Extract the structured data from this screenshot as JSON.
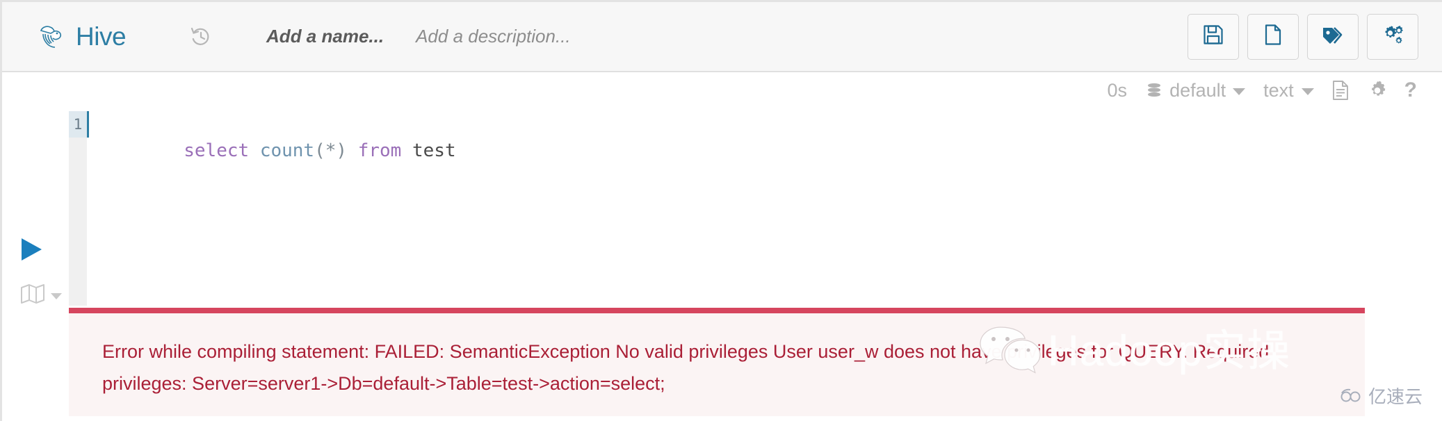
{
  "header": {
    "brand": "Hive",
    "brand_icon": "hive-bee-logo-icon",
    "brand_color": "#2d7ea4",
    "history_icon": "history-revert-icon",
    "name_placeholder": "Add a name...",
    "description_placeholder": "Add a description...",
    "actions": [
      {
        "name": "save-button",
        "icon": "floppy-disk-save-icon",
        "label": "Save"
      },
      {
        "name": "new-query-button",
        "icon": "blank-document-icon",
        "label": "New"
      },
      {
        "name": "tags-button",
        "icon": "tags-label-icon",
        "label": "Tags"
      },
      {
        "name": "settings-button",
        "icon": "gears-settings-icon",
        "label": "Settings"
      }
    ]
  },
  "subbar": {
    "timer": "0s",
    "database_icon": "database-stack-icon",
    "database": "default",
    "result_type": "text",
    "format_icon": "document-lines-icon",
    "settings_icon": "gear-icon",
    "help_icon": "question-mark-icon",
    "help_label": "?",
    "color": "#b3b3b3"
  },
  "left_rail": {
    "run_icon": "play-run-icon",
    "run_color": "#1b7fbd",
    "explain_icon": "map-explain-icon"
  },
  "editor": {
    "line_number": "1",
    "cursor_color": "#2d7ea4",
    "tokens": [
      {
        "text": "select",
        "type": "keyword"
      },
      {
        "text": " ",
        "type": "space"
      },
      {
        "text": "count",
        "type": "function"
      },
      {
        "text": "(*)",
        "type": "punct"
      },
      {
        "text": " ",
        "type": "space"
      },
      {
        "text": "from",
        "type": "keyword"
      },
      {
        "text": " ",
        "type": "space"
      },
      {
        "text": "test",
        "type": "identifier"
      }
    ],
    "query_text": "select count(*) from test"
  },
  "error": {
    "border_color": "#d6455e",
    "background_color": "#fbf4f4",
    "text_color": "#aa1f36",
    "message": "Error while compiling statement: FAILED: SemanticException No valid privileges User user_w does not have privileges for QUERY. Required privileges: Server=server1->Db=default->Table=test->action=select;"
  },
  "watermarks": {
    "center_icon": "wechat-logo-icon",
    "center_text": "Hadoop实操",
    "corner_icon": "yisuyun-cloud-icon",
    "corner_text": "亿速云"
  }
}
